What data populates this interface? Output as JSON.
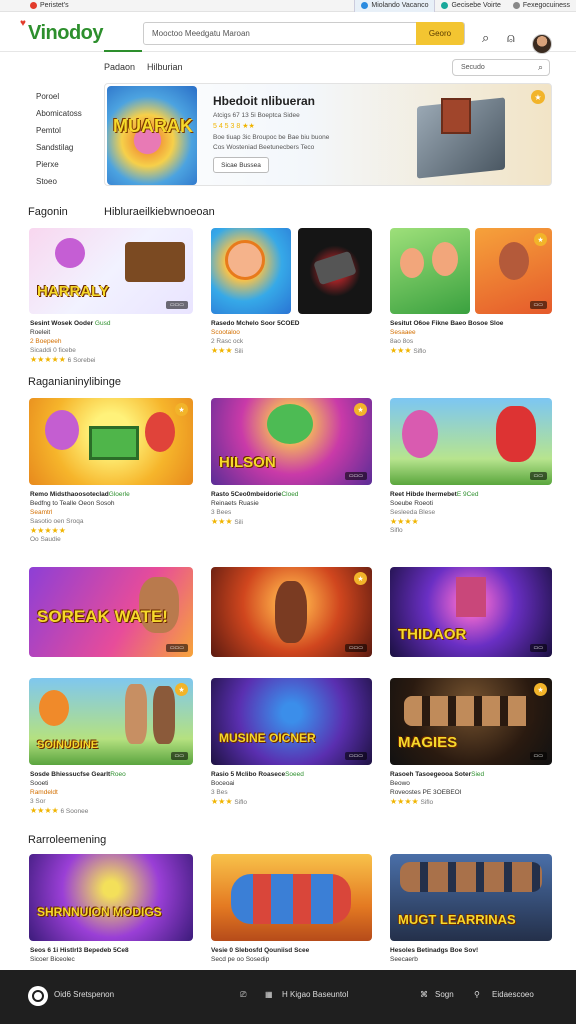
{
  "browser": {
    "tab1": "Peristet's",
    "tab2": "Miolando Vacanco",
    "tab3": "Gecisebe Voirte",
    "tab4": "Fexegocuiness"
  },
  "header": {
    "logo": "Vinodoy",
    "search_placeholder": "Mooctoo  Meedgatu  Maroan",
    "search_button": "Georo"
  },
  "subnav": {
    "item1": "Padaon",
    "item2": "Hilburian",
    "filter_placeholder": "Secudo"
  },
  "sidebar": [
    "Poroel",
    "Abomicatoss",
    "Pemtol",
    "Sandstilag",
    "Pierxe",
    "Stoeo"
  ],
  "hero": {
    "image_title": "MUARAK",
    "title": "Hbedoit nlibueran",
    "line1": "Atcigs 67 13 5i Boeptca Sidee",
    "stars": "5 4 5 3 8  ★★",
    "line2": "Boe tiuap 3ic Broupoc be  Bae biu buone",
    "line3": "Cos Wosteniad  Beetunecbers Teco",
    "button": "Sicae Bussea"
  },
  "sections": {
    "s1_left": "Fagonin",
    "s1_right": "Hibluraeilkiebwnoeoan",
    "s2": "Raganianinylibinge",
    "s3": "Rarroleemening"
  },
  "colors": {
    "accent": "#2d8f2d",
    "search_button": "#f3c531",
    "badge": "#f2b42a",
    "stars": "#f0b400"
  },
  "row1": [
    {
      "title": "Sesint Wosek Ooder ",
      "green": "Gusd",
      "l2": "Roeleit",
      "l3": "2 Boepeeh",
      "l4": "Sicaddi 0 ficebe",
      "stars": "★★★★★",
      "sub": "6 Sorebei",
      "label": "HARRALY"
    },
    {
      "title": "Rasedo Mchelo Soor 5COED",
      "green": "",
      "l2": "Scootaloo",
      "l3": "2 Rasc ock",
      "l4": "",
      "stars": "★★★",
      "sub": "Sili",
      "label": ""
    },
    {
      "title": "Sesitut O6oe Fikne Baeo Bosoe Sloe",
      "green": "",
      "l2": "Sesaaee",
      "l3": "8ao 8os",
      "l4": "",
      "stars": "★★★",
      "sub": "Siflo",
      "label": ""
    }
  ],
  "row2": [
    {
      "title": "Remo  Midsthaoosoteclad",
      "green": "Gloerle",
      "l2": "Bedfng to Tealle Oeon Sosoh",
      "l3": "Seamtrl",
      "l4": "Sasotio oen Sroqa",
      "stars": "★★★★★",
      "sub": "Oo Saudie",
      "label": ""
    },
    {
      "title": "Rasto 5Ceo0mbeidorie",
      "green": "Cloed",
      "l2": "Reinaets  Ruasie",
      "l3": "3 Bees",
      "l4": "",
      "stars": "★★★",
      "sub": "Sili",
      "label": "HILSON"
    },
    {
      "title": "Reet Hibde Ihermebet",
      "green": "E 9Ced",
      "l2": "Soeube  Roeoti",
      "l3": "Sesleeda Blese",
      "l4": "",
      "stars": "★★★★",
      "sub": "Siflo",
      "label": ""
    }
  ],
  "row3": [
    {
      "label": "SOREAK WATE!"
    },
    {
      "label": ""
    },
    {
      "label": "THIDAOR"
    }
  ],
  "row4": [
    {
      "title": "Sosde  Bhiessucfse Gearlt",
      "green": "Roeo",
      "l2": "Sooeti",
      "l3": "Ramdeldt",
      "l4": "3 Sor",
      "stars": "★★★★",
      "sub": "6 Soonee",
      "label": "SOINUDINE"
    },
    {
      "title": "Rasio 5 Mclibo Roasece",
      "green": "Soeed",
      "l2": "Boceoai",
      "l3": "3 Bes",
      "l4": "",
      "stars": "★★★",
      "sub": "Siflo",
      "label": "MUSINE OICNER"
    },
    {
      "title": "Rasoeh  Tasoegeooa  Soter",
      "green": "Sied",
      "l2": "Beowo",
      "l3": "Roveostes PE 3OEBEOI",
      "l4": "",
      "stars": "★★★★",
      "sub": "Siflo",
      "label": "MAGIES"
    }
  ],
  "row5": [
    {
      "title": "Seos 6 1i Histlrl3 Bepedeb 5Ce8",
      "l2": "Sicoer Biceolec",
      "label": "SHRNNUION MODIGS"
    },
    {
      "title": "Vesie 0 Slebosfd Qouniisd Scee",
      "l2": "Secd pe  oo Sosedip",
      "label": ""
    },
    {
      "title": "Hesoles Betinadgs Boe Sov!",
      "l2": "Seecaerb",
      "label": "MUGT LEARRINAS"
    }
  ],
  "footer": {
    "brand": "Oid6 Sretspenon",
    "center": "H  Kigao Baseuntol",
    "r1": "Sogn",
    "r2": "Eidaescoeo"
  }
}
